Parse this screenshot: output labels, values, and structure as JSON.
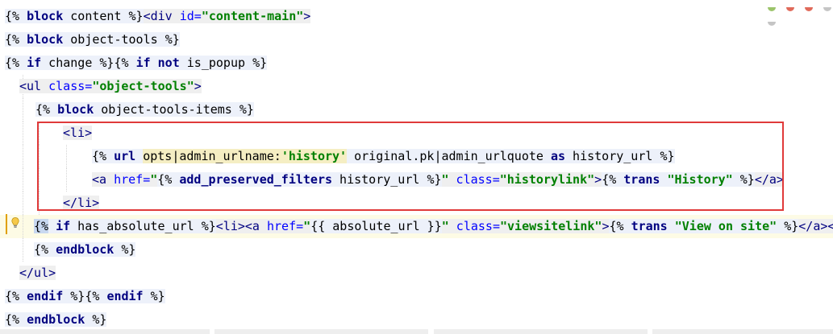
{
  "lines": [
    {
      "parts": [
        {
          "t": "{% ",
          "c": "tpl"
        },
        {
          "t": "block",
          "c": "kw tpl"
        },
        {
          "t": " content ",
          "c": "tpl"
        },
        {
          "t": "%}",
          "c": "tpl"
        },
        {
          "t": "<div ",
          "c": "tag tagbg"
        },
        {
          "t": "id=",
          "c": "attr tagbg"
        },
        {
          "t": "\"content-main\"",
          "c": "str tagbg"
        },
        {
          "t": ">",
          "c": "tag tagbg"
        }
      ]
    },
    {
      "parts": [
        {
          "t": "{% ",
          "c": "tpl"
        },
        {
          "t": "block",
          "c": "kw tpl"
        },
        {
          "t": " object-tools ",
          "c": "tpl"
        },
        {
          "t": "%}",
          "c": "tpl"
        }
      ]
    },
    {
      "parts": [
        {
          "t": "{% ",
          "c": "tpl"
        },
        {
          "t": "if",
          "c": "kw tpl"
        },
        {
          "t": " change ",
          "c": "tpl"
        },
        {
          "t": "%}",
          "c": "tpl"
        },
        {
          "t": "{% ",
          "c": "tpl"
        },
        {
          "t": "if not",
          "c": "kw tpl"
        },
        {
          "t": " is_popup ",
          "c": "tpl"
        },
        {
          "t": "%}",
          "c": "tpl"
        }
      ]
    },
    {
      "parts": [
        {
          "t": "<ul ",
          "c": "tag tagbg"
        },
        {
          "t": "class=",
          "c": "attr tagbg"
        },
        {
          "t": "\"object-tools\"",
          "c": "str tagbg"
        },
        {
          "t": ">",
          "c": "tag tagbg"
        }
      ]
    },
    {
      "parts": [
        {
          "t": "{% ",
          "c": "tpl"
        },
        {
          "t": "block",
          "c": "kw tpl"
        },
        {
          "t": " object-tools-items ",
          "c": "tpl"
        },
        {
          "t": "%}",
          "c": "tpl"
        }
      ]
    },
    {
      "parts": [
        {
          "t": "<li>",
          "c": "tag tagbg"
        }
      ]
    },
    {
      "parts": [
        {
          "t": "{% ",
          "c": "tpl"
        },
        {
          "t": "url",
          "c": "kw tpl"
        },
        {
          "t": " ",
          "c": "tpl"
        },
        {
          "t": "opts|admin_urlname:",
          "c": "tpl hlw"
        },
        {
          "t": "'history'",
          "c": "str tpl hlw"
        },
        {
          "t": " original.pk|admin_urlquote ",
          "c": "tpl"
        },
        {
          "t": "as",
          "c": "kw tpl"
        },
        {
          "t": " history_url ",
          "c": "tpl"
        },
        {
          "t": "%}",
          "c": "tpl"
        }
      ]
    },
    {
      "parts": [
        {
          "t": "<a ",
          "c": "tag tagbg"
        },
        {
          "t": "href=",
          "c": "attr tagbg"
        },
        {
          "t": "\"",
          "c": "str tagbg"
        },
        {
          "t": "{% ",
          "c": "tpl"
        },
        {
          "t": "add_preserved_filters",
          "c": "kw tpl"
        },
        {
          "t": " history_url ",
          "c": "tpl"
        },
        {
          "t": "%}",
          "c": "tpl"
        },
        {
          "t": "\"",
          "c": "str tagbg"
        },
        {
          "t": " class=",
          "c": "attr tagbg"
        },
        {
          "t": "\"historylink\"",
          "c": "str tagbg"
        },
        {
          "t": ">",
          "c": "tag tagbg"
        },
        {
          "t": "{% ",
          "c": "tpl"
        },
        {
          "t": "trans",
          "c": "kw tpl"
        },
        {
          "t": " ",
          "c": "tpl"
        },
        {
          "t": "\"History\"",
          "c": "str tpl"
        },
        {
          "t": " %}",
          "c": "tpl"
        },
        {
          "t": "</a>",
          "c": "tag tagbg"
        }
      ]
    },
    {
      "parts": [
        {
          "t": "</li>",
          "c": "tag tagbg"
        }
      ]
    },
    {
      "parts": [
        {
          "t": "{%",
          "c": "tpl sel"
        },
        {
          "t": " ",
          "c": "tpl"
        },
        {
          "t": "if",
          "c": "kw tpl"
        },
        {
          "t": " has_absolute_url ",
          "c": "tpl"
        },
        {
          "t": "%}",
          "c": "tpl"
        },
        {
          "t": "<li><a ",
          "c": "tag tagbg"
        },
        {
          "t": "href=",
          "c": "attr tagbg"
        },
        {
          "t": "\"",
          "c": "str tagbg"
        },
        {
          "t": "{{ absolute_url }}",
          "c": "tpl"
        },
        {
          "t": "\"",
          "c": "str tagbg"
        },
        {
          "t": " class=",
          "c": "attr tagbg"
        },
        {
          "t": "\"viewsitelink\"",
          "c": "str tagbg"
        },
        {
          "t": ">",
          "c": "tag tagbg"
        },
        {
          "t": "{% ",
          "c": "tpl"
        },
        {
          "t": "trans",
          "c": "kw tpl"
        },
        {
          "t": " ",
          "c": "tpl"
        },
        {
          "t": "\"View on site\"",
          "c": "str tpl"
        },
        {
          "t": " %}",
          "c": "tpl"
        },
        {
          "t": "</a><",
          "c": "tag tagbg"
        }
      ]
    },
    {
      "parts": [
        {
          "t": "{% ",
          "c": "tpl"
        },
        {
          "t": "endblock",
          "c": "kw tpl"
        },
        {
          "t": " %}",
          "c": "tpl"
        }
      ]
    },
    {
      "parts": [
        {
          "t": "</ul>",
          "c": "tag tagbg"
        }
      ]
    },
    {
      "parts": [
        {
          "t": "{% ",
          "c": "tpl"
        },
        {
          "t": "endif",
          "c": "kw tpl"
        },
        {
          "t": " %}",
          "c": "tpl"
        },
        {
          "t": "{% ",
          "c": "tpl"
        },
        {
          "t": "endif",
          "c": "kw tpl"
        },
        {
          "t": " %}",
          "c": "tpl"
        }
      ]
    },
    {
      "parts": [
        {
          "t": "{% ",
          "c": "tpl"
        },
        {
          "t": "endblock",
          "c": "kw tpl"
        },
        {
          "t": " %}",
          "c": "tpl"
        }
      ]
    }
  ],
  "colors": {
    "highlight_box": "#e03a3a",
    "keyword": "#000080",
    "string": "#008000",
    "attribute": "#0000ff"
  },
  "icons": [
    "lightbulb-icon"
  ]
}
